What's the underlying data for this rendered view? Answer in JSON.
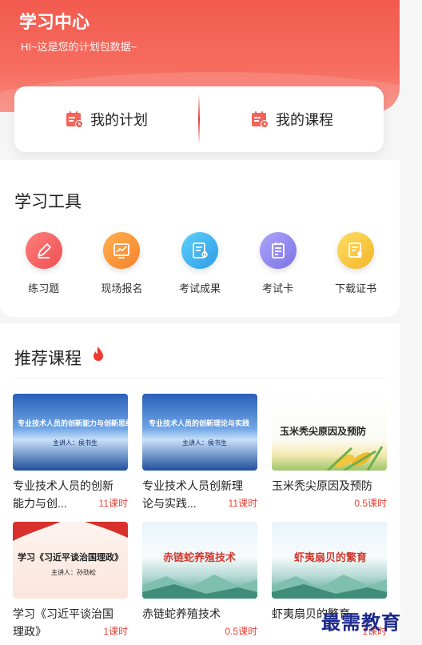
{
  "header": {
    "title": "学习中心",
    "subtitle": "HI~这是您的计划包数据~"
  },
  "tabs": [
    {
      "label": "我的计划",
      "icon": "calendar-icon"
    },
    {
      "label": "我的课程",
      "icon": "calendar-icon"
    }
  ],
  "tools": {
    "title": "学习工具",
    "items": [
      {
        "label": "练习题",
        "icon": "pencil-icon",
        "color": "#f0565a"
      },
      {
        "label": "现场报名",
        "icon": "chart-icon",
        "color": "#f7923a"
      },
      {
        "label": "考试成果",
        "icon": "document-icon",
        "color": "#3ab0ee"
      },
      {
        "label": "考试卡",
        "icon": "card-icon",
        "color": "#8f86ee"
      },
      {
        "label": "下载证书",
        "icon": "certificate-icon",
        "color": "#f5c73a"
      }
    ]
  },
  "recommend": {
    "title": "推荐课程",
    "courses": [
      {
        "title_line1": "专业技术人员的创新",
        "title_line2": "能力与创...",
        "hours": "11课时",
        "thumb_title": "专业技术人员的创新能力与创新思维",
        "thumb_speaker": "主讲人：侯书生"
      },
      {
        "title_line1": "专业技术人员创新理",
        "title_line2": "论与实践...",
        "hours": "11课时",
        "thumb_title": "专业技术人员的创新理论与实践",
        "thumb_speaker": "主讲人：侯书生"
      },
      {
        "title_line1": "玉米秃尖原因及预防",
        "title_line2": "",
        "hours": "0.5课时",
        "thumb_title": "玉米秃尖原因及预防",
        "thumb_speaker": ""
      },
      {
        "title_line1": "学习《习近平谈治国",
        "title_line2": "理政》",
        "hours": "1课时",
        "thumb_title": "学习《习近平谈治国理政》",
        "thumb_speaker": "主讲人：孙劲松"
      },
      {
        "title_line1": "赤链蛇养殖技术",
        "title_line2": "",
        "hours": "0.5课时",
        "thumb_title": "赤链蛇养殖技术",
        "thumb_speaker": ""
      },
      {
        "title_line1": "虾夷扇贝的繁育",
        "title_line2": "",
        "hours": "1课时",
        "thumb_title": "虾夷扇贝的繁育",
        "thumb_speaker": ""
      }
    ]
  },
  "watermark": "最需教育"
}
